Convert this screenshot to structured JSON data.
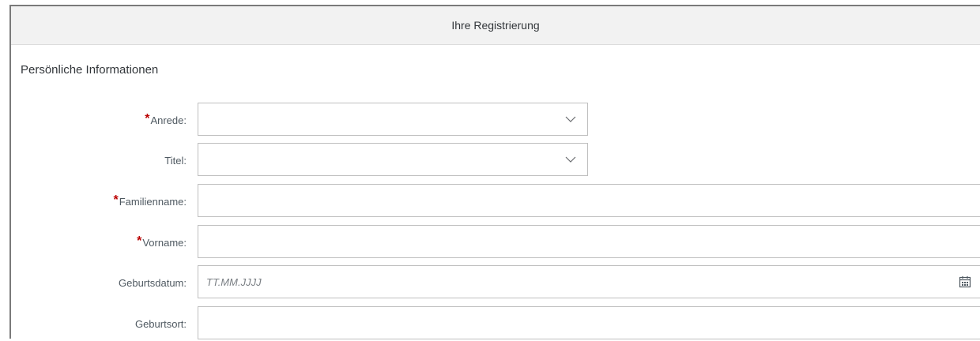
{
  "header": {
    "title": "Ihre Registrierung"
  },
  "section": {
    "title": "Persönliche Informationen"
  },
  "fields": [
    {
      "label": "Anrede:",
      "required": true,
      "type": "select",
      "value": ""
    },
    {
      "label": "Titel:",
      "required": false,
      "type": "select",
      "value": ""
    },
    {
      "label": "Familienname:",
      "required": true,
      "type": "text",
      "value": ""
    },
    {
      "label": "Vorname:",
      "required": true,
      "type": "text",
      "value": ""
    },
    {
      "label": "Geburtsdatum:",
      "required": false,
      "type": "date",
      "value": "",
      "placeholder": "TT.MM.JJJJ"
    },
    {
      "label": "Geburtsort:",
      "required": false,
      "type": "text",
      "value": ""
    }
  ],
  "icons": {
    "dropdown": "chevron-down-icon",
    "date": "calendar-icon"
  },
  "colors": {
    "required_marker": "#bb0000",
    "header_bg": "#f2f2f2",
    "field_border": "#bfbfbf"
  }
}
